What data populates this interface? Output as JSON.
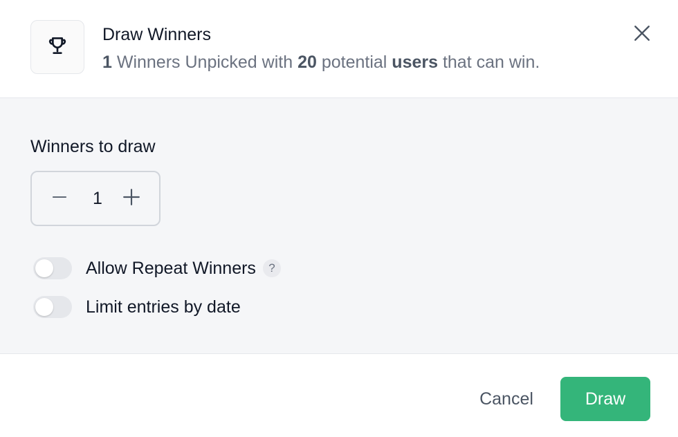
{
  "header": {
    "icon": "trophy-icon",
    "title": "Draw Winners",
    "subtitle": {
      "winners_count": "1",
      "text_winners_unpicked": " Winners Unpicked with ",
      "potential_count": "20",
      "text_potential": " potential ",
      "users_word": "users",
      "text_end": " that can win."
    },
    "close_icon": "close-icon"
  },
  "body": {
    "winners_label": "Winners to draw",
    "stepper": {
      "value": "1",
      "minus_icon": "minus-icon",
      "plus_icon": "plus-icon"
    },
    "toggles": [
      {
        "label": "Allow Repeat Winners",
        "enabled": false,
        "help": "?"
      },
      {
        "label": "Limit entries by date",
        "enabled": false
      }
    ]
  },
  "footer": {
    "cancel_label": "Cancel",
    "draw_label": "Draw"
  },
  "colors": {
    "primary": "#34b57a",
    "body_bg": "#f5f6f8",
    "text_muted": "#6b7280",
    "border": "#e5e7eb"
  }
}
